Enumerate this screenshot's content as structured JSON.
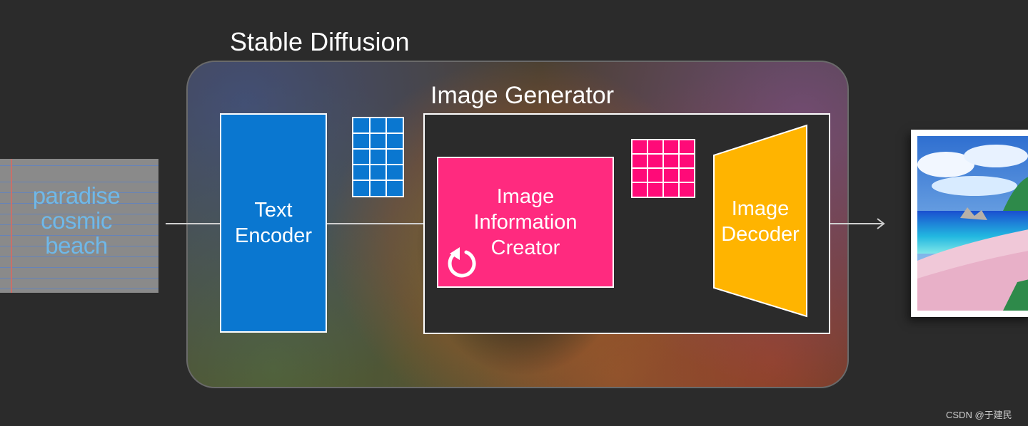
{
  "input": {
    "lines": [
      "paradise",
      "cosmic",
      "beach"
    ]
  },
  "stable_diffusion": {
    "title": "Stable Diffusion"
  },
  "text_encoder": {
    "lines": [
      "Text",
      "Encoder"
    ]
  },
  "image_generator": {
    "title": "Image Generator",
    "creator": {
      "lines": [
        "Image",
        "Information",
        "Creator"
      ],
      "icon": "refresh-loop-icon"
    },
    "decoder": {
      "lines": [
        "Image",
        "Decoder"
      ]
    }
  },
  "watermark": "CSDN @于建民",
  "colors": {
    "background": "#2b2b2b",
    "text_encoder": "#0a77d0",
    "image_information_creator": "#ff2a7f",
    "latent_grid": "#ff0a78",
    "image_decoder": "#ffb400",
    "input_text": "#6fb8e8",
    "arrow": "#d0d0d0"
  }
}
